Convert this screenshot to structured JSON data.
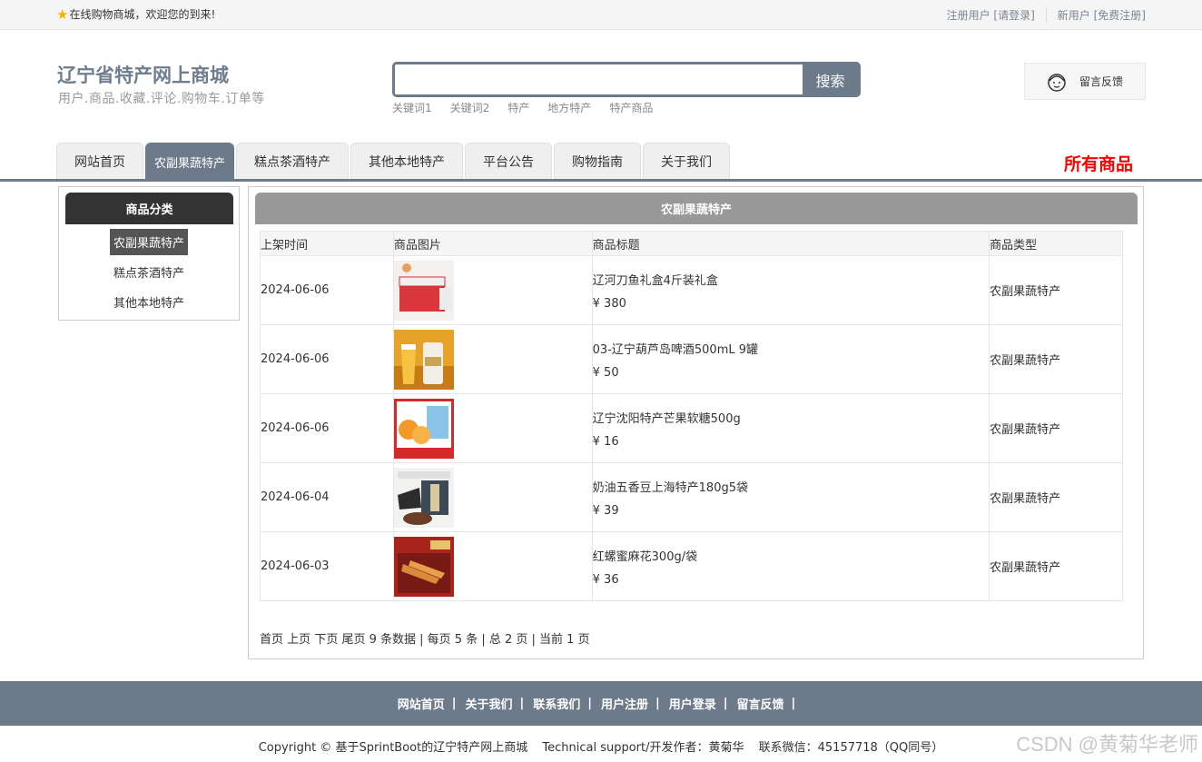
{
  "topbar": {
    "welcome": "在线购物商城，欢迎您的到来!",
    "register_user": "注册用户",
    "login": "[请登录]",
    "new_user": "新用户",
    "free_register": "[免费注册]"
  },
  "header": {
    "title": "辽宁省特产网上商城",
    "subtitle": "用户.商品.收藏.评论.购物车.订单等",
    "search_placeholder": "",
    "search_button": "搜索",
    "keywords": [
      "关键词1",
      "关键词2",
      "特产",
      "地方特产",
      "特产商品"
    ],
    "feedback": "留言反馈"
  },
  "nav": {
    "tabs": [
      "网站首页",
      "农副果蔬特产",
      "糕点茶酒特产",
      "其他本地特产",
      "平台公告",
      "购物指南",
      "关于我们"
    ],
    "all_goods": "所有商品"
  },
  "sidebar": {
    "title": "商品分类",
    "items": [
      "农副果蔬特产",
      "糕点茶酒特产",
      "其他本地特产"
    ]
  },
  "main": {
    "title": "农副果蔬特产",
    "columns": [
      "上架时间",
      "商品图片",
      "商品标题",
      "商品类型"
    ],
    "rows": [
      {
        "date": "2024-06-06",
        "title": "辽河刀鱼礼盒4斤装礼盒",
        "price": "¥ 380",
        "type": "农副果蔬特产"
      },
      {
        "date": "2024-06-06",
        "title": "03-辽宁葫芦岛啤酒500mL 9罐",
        "price": "¥ 50",
        "type": "农副果蔬特产"
      },
      {
        "date": "2024-06-06",
        "title": "辽宁沈阳特产芒果软糖500g",
        "price": "¥ 16",
        "type": "农副果蔬特产"
      },
      {
        "date": "2024-06-04",
        "title": "奶油五香豆上海特产180g5袋",
        "price": "¥ 39",
        "type": "农副果蔬特产"
      },
      {
        "date": "2024-06-03",
        "title": "红螺蜜麻花300g/袋",
        "price": "¥ 36",
        "type": "农副果蔬特产"
      }
    ],
    "pager": {
      "first": "首页",
      "prev": "上页",
      "next": "下页",
      "last": "尾页",
      "summary": "9 条数据 | 每页 5 条 | 总 2 页 | 当前 1 页"
    }
  },
  "footer": {
    "links": [
      "网站首页",
      "关于我们",
      "联系我们",
      "用户注册",
      "用户登录",
      "留言反馈"
    ],
    "copyright": "Copyright © 基于SprintBoot的辽宁特产网上商城",
    "support": "Technical support/开发作者：黄菊华",
    "contact": "联系微信：45157718（QQ同号）",
    "watermark": "CSDN @黄菊华老师"
  }
}
